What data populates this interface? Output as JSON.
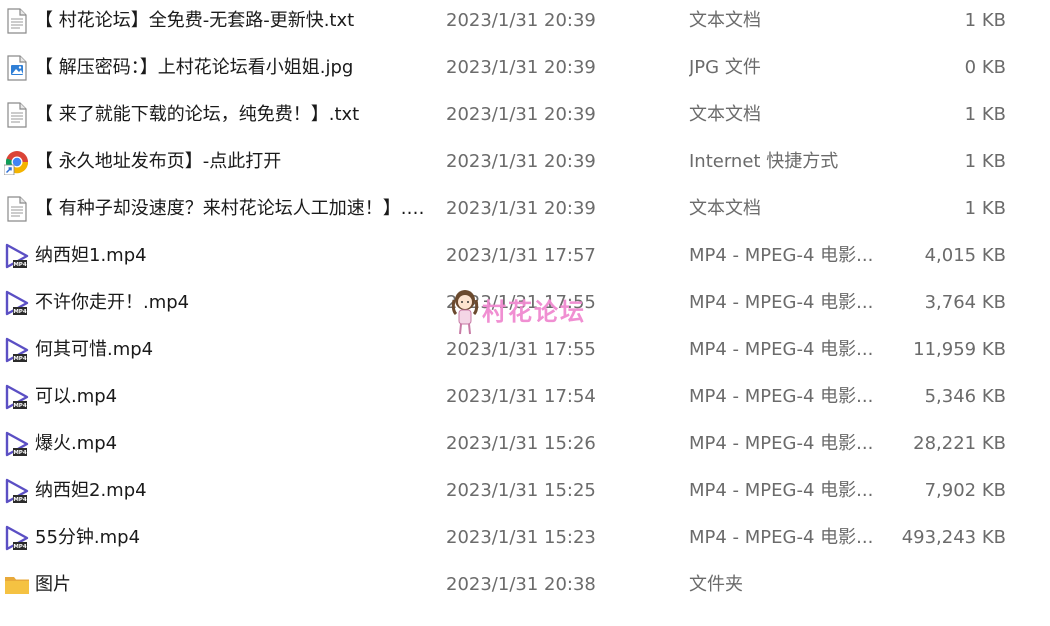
{
  "files": [
    {
      "icon": "text-file-icon",
      "name": "【 村花论坛】全免费-无套路-更新快.txt",
      "modified": "2023/1/31 20:39",
      "type": "文本文档",
      "size": "1 KB"
    },
    {
      "icon": "image-file-icon",
      "name": "【 解压密码：】上村花论坛看小姐姐.jpg",
      "modified": "2023/1/31 20:39",
      "type": "JPG 文件",
      "size": "0 KB"
    },
    {
      "icon": "text-file-icon",
      "name": "【 来了就能下载的论坛，纯免费！】.txt",
      "modified": "2023/1/31 20:39",
      "type": "文本文档",
      "size": "1 KB"
    },
    {
      "icon": "internet-shortcut-icon",
      "name": "【 永久地址发布页】-点此打开",
      "modified": "2023/1/31 20:39",
      "type": "Internet 快捷方式",
      "size": "1 KB"
    },
    {
      "icon": "text-file-icon",
      "name": "【 有种子却没速度？来村花论坛人工加速！】.t...",
      "modified": "2023/1/31 20:39",
      "type": "文本文档",
      "size": "1 KB"
    },
    {
      "icon": "video-file-icon",
      "name": "纳西妲1.mp4",
      "modified": "2023/1/31 17:57",
      "type": "MP4 - MPEG-4 电影...",
      "size": "4,015 KB"
    },
    {
      "icon": "video-file-icon",
      "name": "不许你走开！.mp4",
      "modified": "2023/1/31 17:55",
      "type": "MP4 - MPEG-4 电影...",
      "size": "3,764 KB"
    },
    {
      "icon": "video-file-icon",
      "name": "何其可惜.mp4",
      "modified": "2023/1/31 17:55",
      "type": "MP4 - MPEG-4 电影...",
      "size": "11,959 KB"
    },
    {
      "icon": "video-file-icon",
      "name": "可以.mp4",
      "modified": "2023/1/31 17:54",
      "type": "MP4 - MPEG-4 电影...",
      "size": "5,346 KB"
    },
    {
      "icon": "video-file-icon",
      "name": "爆火.mp4",
      "modified": "2023/1/31 15:26",
      "type": "MP4 - MPEG-4 电影...",
      "size": "28,221 KB"
    },
    {
      "icon": "video-file-icon",
      "name": "纳西妲2.mp4",
      "modified": "2023/1/31 15:25",
      "type": "MP4 - MPEG-4 电影...",
      "size": "7,902 KB"
    },
    {
      "icon": "video-file-icon",
      "name": "55分钟.mp4",
      "modified": "2023/1/31 15:23",
      "type": "MP4 - MPEG-4 电影...",
      "size": "493,243 KB"
    },
    {
      "icon": "folder-icon",
      "name": "图片",
      "modified": "2023/1/31 20:38",
      "type": "文件夹",
      "size": ""
    }
  ],
  "watermark": {
    "text": "村花论坛",
    "color": "#f08ad0"
  },
  "colors": {
    "name_text": "#1a1a1a",
    "meta_text": "#6b6b6b",
    "video_icon": "#5b4fc4",
    "folder_icon": "#f5c242"
  }
}
